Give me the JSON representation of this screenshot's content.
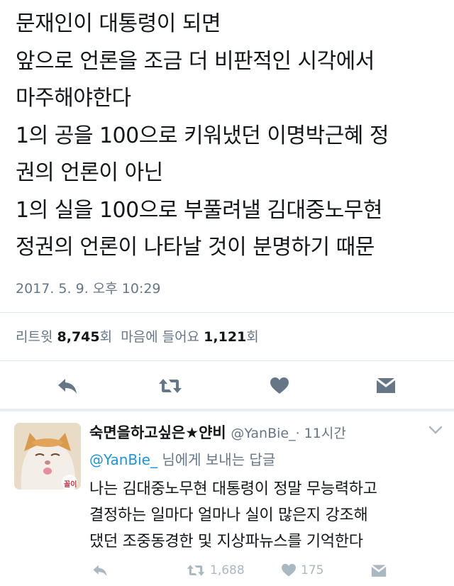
{
  "tweet": {
    "lines": [
      "문재인이 대통령이 되면",
      "앞으로 언론을 조금 더 비판적인 시각에서",
      "마주해야한다",
      "1의 공을 100으로 키워냈던 이명박근혜 정",
      "권의 언론이 아닌",
      "1의 실을 100으로 부풀려낼 김대중노무현",
      "정권의 언론이 나타날 것이 분명하기 때문"
    ],
    "timestamp": "2017. 5. 9. 오후 10:29",
    "retweet_label": "리트윗",
    "retweet_count": "8,745",
    "count_suffix": "회",
    "like_label": "마음에 들어요",
    "like_count": "1,121"
  },
  "reply": {
    "name": "숙면을하고싶은★얀비",
    "handle": "@YanBie_",
    "time": "· 11시간",
    "replying_to": "@YanBie_",
    "replying_suffix": "님에게 보내는 답글",
    "avatar_caption": "꼴이",
    "lines": [
      "나는 김대중노무현 대통령이 정말 무능력하고",
      "결정하는 일마다 얼마나 실이 많은지 강조해",
      "댔던 조중동경한 및 지상파뉴스를 기억한다"
    ],
    "retweets": "1,688",
    "likes": "175"
  },
  "colors": {
    "text": "#14171a",
    "secondary": "#657786",
    "icon": "#657786",
    "icon_light": "#aab8c2",
    "link": "#1b95e0",
    "divider": "#e1e8ed"
  },
  "icons": [
    "reply-icon",
    "retweet-icon",
    "heart-icon",
    "dm-icon",
    "chevron-down-icon"
  ]
}
